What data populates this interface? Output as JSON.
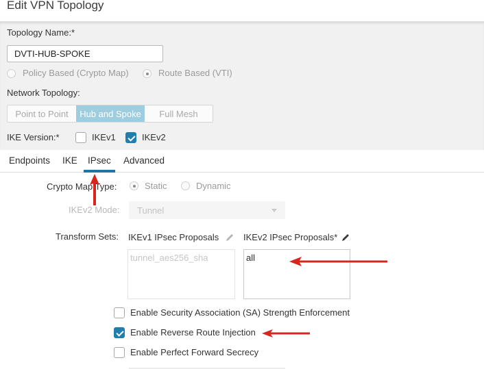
{
  "header": {
    "title": "Edit VPN Topology"
  },
  "topology": {
    "name_label": "Topology Name:*",
    "name_value": "DVTI-HUB-SPOKE",
    "type_options": [
      {
        "label": "Policy Based (Crypto Map)",
        "selected": false
      },
      {
        "label": "Route Based (VTI)",
        "selected": true
      }
    ],
    "network_topology_label": "Network Topology:",
    "network_topology_options": [
      {
        "label": "Point to Point",
        "active": false
      },
      {
        "label": "Hub and Spoke",
        "active": true
      },
      {
        "label": "Full Mesh",
        "active": false
      }
    ],
    "ike_version_label": "IKE Version:*",
    "ike_versions": [
      {
        "label": "IKEv1",
        "checked": false
      },
      {
        "label": "IKEv2",
        "checked": true
      }
    ]
  },
  "tabs": [
    {
      "label": "Endpoints",
      "active": false
    },
    {
      "label": "IKE",
      "active": false
    },
    {
      "label": "IPsec",
      "active": true
    },
    {
      "label": "Advanced",
      "active": false
    }
  ],
  "ipsec": {
    "crypto_map_type_label": "Crypto Map Type:",
    "crypto_map_options": [
      {
        "label": "Static",
        "selected": true
      },
      {
        "label": "Dynamic",
        "selected": false
      }
    ],
    "ikev2_mode_label": "IKEv2 Mode:",
    "ikev2_mode_value": "Tunnel",
    "transform_sets_label": "Transform Sets:",
    "ikev1_proposals_label": "IKEv1 IPsec Proposals",
    "ikev1_proposals": [
      "tunnel_aes256_sha"
    ],
    "ikev2_proposals_label": "IKEv2 IPsec Proposals*",
    "ikev2_proposals": [
      "all"
    ],
    "options": [
      {
        "label": "Enable Security Association (SA) Strength Enforcement",
        "checked": false
      },
      {
        "label": "Enable Reverse Route Injection",
        "checked": true
      },
      {
        "label": "Enable Perfect Forward Secrecy",
        "checked": false
      }
    ]
  },
  "annotation_color": "#d7261e",
  "accent_color": "#1f74a6"
}
